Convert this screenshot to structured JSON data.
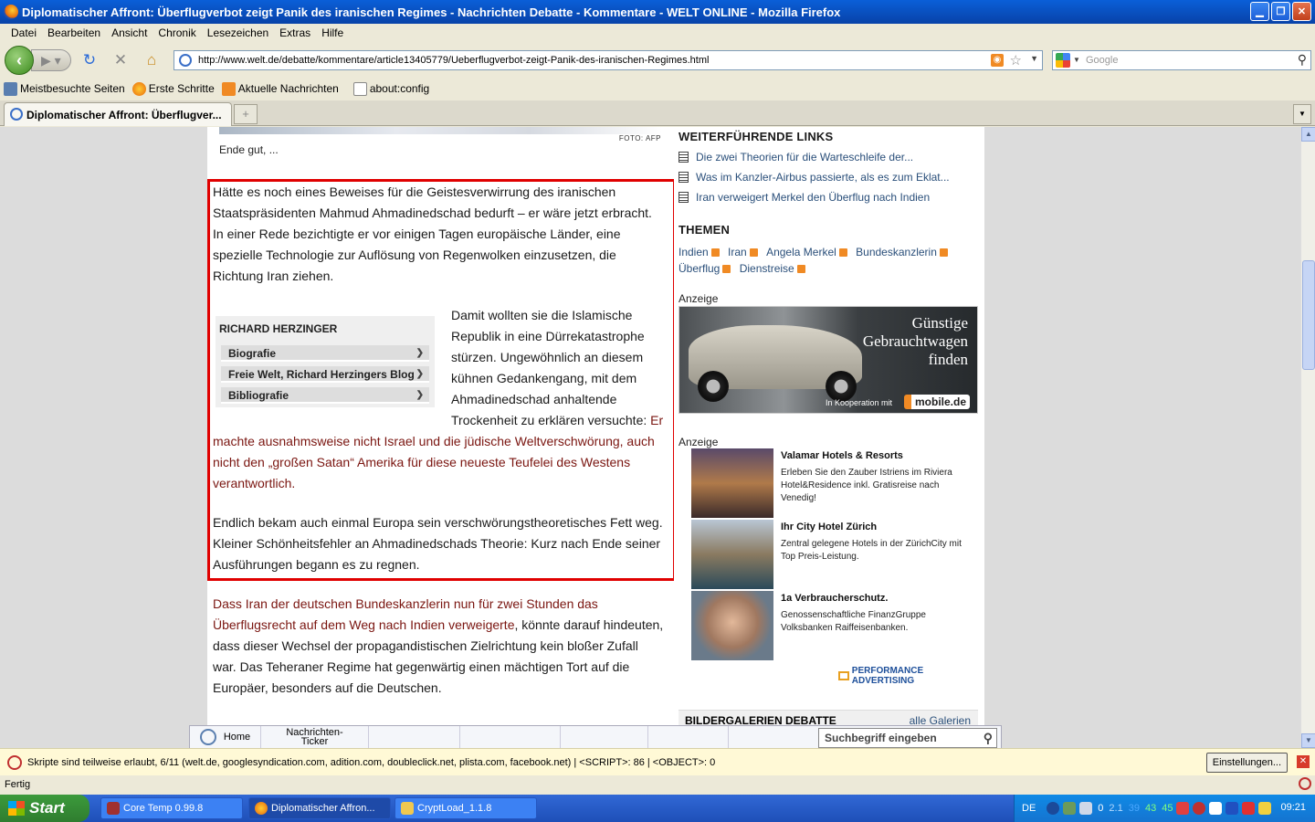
{
  "window": {
    "title": "Diplomatischer Affront: Überflugverbot zeigt Panik des iranischen Regimes - Nachrichten Debatte - Kommentare - WELT ONLINE - Mozilla Firefox"
  },
  "menu": [
    "Datei",
    "Bearbeiten",
    "Ansicht",
    "Chronik",
    "Lesezeichen",
    "Extras",
    "Hilfe"
  ],
  "nav": {
    "url": "http://www.welt.de/debatte/kommentare/article13405779/Ueberflugverbot-zeigt-Panik-des-iranischen-Regimes.html",
    "search_placeholder": "Google"
  },
  "bookmarks": [
    "Meistbesuchte Seiten",
    "Erste Schritte",
    "Aktuelle Nachrichten",
    "about:config"
  ],
  "tab": {
    "label": "Diplomatischer Affront: Überflugver..."
  },
  "article": {
    "foto_credit": "FOTO: AFP",
    "caption": "Ende gut, ...",
    "para1": "Hätte es noch eines Beweises für die Geistesverwirrung des iranischen Staatspräsidenten Mahmud Ahmadinedschad bedurft – er wäre jetzt erbracht. In einer Rede bezichtigte er vor einigen Tagen europäische Länder, eine spezielle Technologie zur Auflösung von Regenwolken einzusetzen, die Richtung Iran ziehen.",
    "para2_lines": [
      "Damit wollten sie die Islamische",
      "Republik in eine Dürrekatastrophe",
      "stürzen. Ungewöhnlich an diesem",
      "kühnen Gedankengang, mit dem",
      "Ahmadinedschad anhaltende"
    ],
    "para2_tail": "Trockenheit zu erklären versuchte: ",
    "para2_link_first": "Er",
    "para2_link_rest": "machte ausnahmsweise nicht Israel und die jüdische Weltverschwörung, auch nicht den „großen Satan“ Amerika für diese neueste Teufelei des Westens verantwortlich.",
    "para3": "Endlich bekam auch einmal Europa sein verschwörungstheoretisches Fett weg. Kleiner Schönheitsfehler an Ahmadinedschads Theorie: Kurz nach Ende seiner Ausführungen begann es zu regnen.",
    "para4_link": "Dass Iran der deutschen Bundeskanzlerin nun für zwei Stunden das Überflugsrecht auf dem Weg nach Indien verweigerte",
    "para4_rest": ", könnte darauf hindeuten, dass dieser Wechsel der propagandistischen Zielrichtung kein bloßer Zufall war. Das Teheraner Regime hat gegenwärtig einen mächtigen Tort auf die Europäer, besonders auf die Deutschen.",
    "author": {
      "name": "RICHARD HERZINGER",
      "sections": [
        "Biografie",
        "Freie Welt, Richard Herzingers Blog",
        "Bibliografie"
      ]
    }
  },
  "sidebar": {
    "links_heading": "WEITERFÜHRENDE LINKS",
    "links": [
      "Die zwei Theorien für die Warteschleife der...",
      "Was im Kanzler-Airbus passierte, als es zum Eklat...",
      "Iran verweigert Merkel den Überflug nach Indien"
    ],
    "themes_heading": "THEMEN",
    "themes": [
      "Indien",
      "Iran",
      "Angela Merkel",
      "Bundeskanzlerin",
      "Überflug",
      "Dienstreise"
    ],
    "ad_label": "Anzeige",
    "banner": {
      "headline": [
        "Günstige",
        "Gebrauchtwagen",
        "finden"
      ],
      "koop": "In Kooperation mit",
      "brand": "mobile.de"
    },
    "ads": [
      {
        "title": "Valamar Hotels & Resorts",
        "text": "Erleben Sie den Zauber Istriens im Riviera Hotel&Residence inkl. Gratisreise nach Venedig!"
      },
      {
        "title": "Ihr City Hotel Zürich",
        "text": "Zentral gelegene Hotels in der ZürichCity mit Top Preis-Leistung."
      },
      {
        "title": "1a Verbraucherschutz.",
        "text": "Genossenschaftliche FinanzGruppe Volksbanken Raiffeisenbanken."
      }
    ],
    "performance": "PERFORMANCE ADVERTISING",
    "gallery_heading": "BILDERGALERIEN DEBATTE",
    "gallery_link": "alle Galerien"
  },
  "welt_toolbar": {
    "home": "Home",
    "ticker": "Nachrichten-Ticker",
    "search_placeholder": "Suchbegriff eingeben"
  },
  "noscript": {
    "message": "Skripte sind teilweise erlaubt, 6/11 (welt.de, googlesyndication.com, adition.com, doubleclick.net, plista.com, facebook.net) | <SCRIPT>: 86 | <OBJECT>: 0",
    "button": "Einstellungen..."
  },
  "status": "Fertig",
  "taskbar": {
    "start": "Start",
    "tasks": [
      "Core Temp 0.99.8",
      "Diplomatischer Affron...",
      "CryptLoad_1.1.8"
    ],
    "lang": "DE",
    "temps": [
      "0",
      "2.1",
      "39",
      "43",
      "45"
    ],
    "clock": "09:21"
  }
}
